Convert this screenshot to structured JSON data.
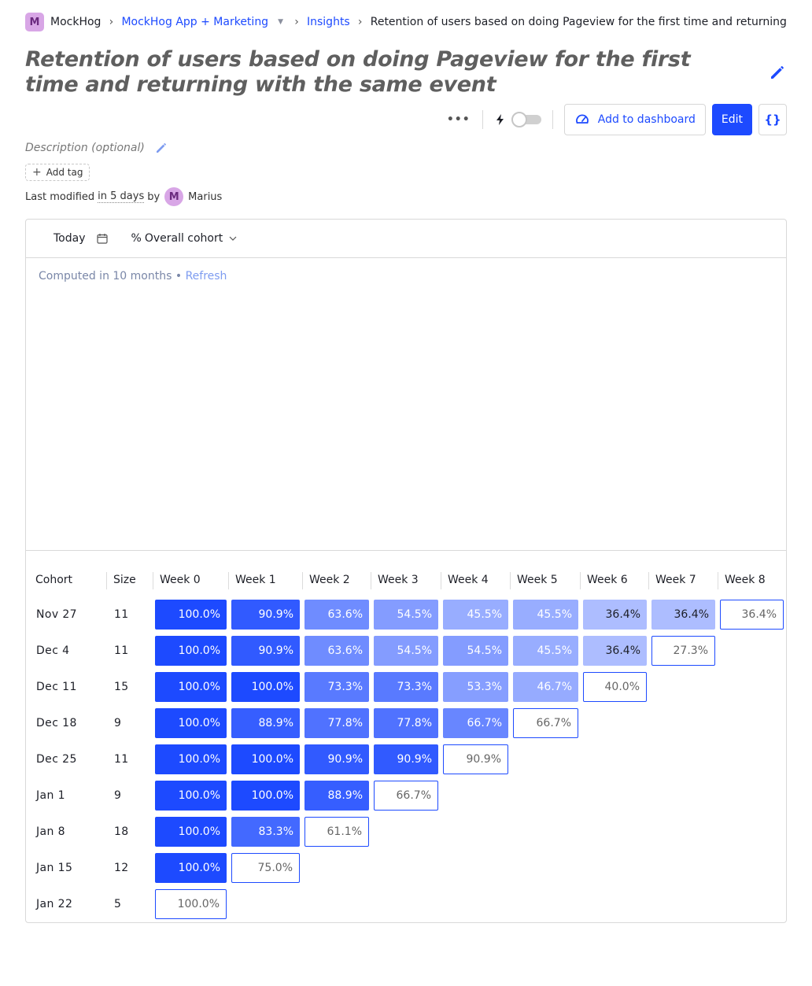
{
  "breadcrumbs": {
    "org_initial": "M",
    "org": "MockHog",
    "project": "MockHog App + Marketing",
    "section": "Insights",
    "current": "Retention of users based on doing Pageview for the first time and returning with the same event"
  },
  "title": "Retention of users based on doing Pageview for the first time and returning with the same event",
  "toolbar": {
    "more_label": "•••",
    "add_to_dashboard": "Add to dashboard",
    "edit": "Edit",
    "code_label": "{}"
  },
  "description_placeholder": "Description (optional)",
  "add_tag": "Add tag",
  "last_modified": {
    "prefix": "Last modified",
    "relative": "in 5 days",
    "by": "by",
    "user_initial": "M",
    "user": "Marius"
  },
  "filters": {
    "date": "Today",
    "cohort_mode": "Overall cohort",
    "cohort_prefix": "%"
  },
  "computed": {
    "text": "Computed in 10 months",
    "bullet": "•",
    "refresh": "Refresh"
  },
  "colors": {
    "accent": "#1d4aff",
    "cell_base_rgb": "29,74,255"
  },
  "chart_data": {
    "type": "table",
    "columns": [
      "Cohort",
      "Size",
      "Week 0",
      "Week 1",
      "Week 2",
      "Week 3",
      "Week 4",
      "Week 5",
      "Week 6",
      "Week 7",
      "Week 8"
    ],
    "rows": [
      {
        "cohort": "Nov 27",
        "size": "11",
        "values": [
          "100.0%",
          "90.9%",
          "63.6%",
          "54.5%",
          "45.5%",
          "45.5%",
          "36.4%",
          "36.4%",
          "36.4%"
        ]
      },
      {
        "cohort": "Dec 4",
        "size": "11",
        "values": [
          "100.0%",
          "90.9%",
          "63.6%",
          "54.5%",
          "54.5%",
          "45.5%",
          "36.4%",
          "27.3%"
        ]
      },
      {
        "cohort": "Dec 11",
        "size": "15",
        "values": [
          "100.0%",
          "100.0%",
          "73.3%",
          "73.3%",
          "53.3%",
          "46.7%",
          "40.0%"
        ]
      },
      {
        "cohort": "Dec 18",
        "size": "9",
        "values": [
          "100.0%",
          "88.9%",
          "77.8%",
          "77.8%",
          "66.7%",
          "66.7%"
        ]
      },
      {
        "cohort": "Dec 25",
        "size": "11",
        "values": [
          "100.0%",
          "100.0%",
          "90.9%",
          "90.9%",
          "90.9%"
        ]
      },
      {
        "cohort": "Jan 1",
        "size": "9",
        "values": [
          "100.0%",
          "100.0%",
          "88.9%",
          "66.7%"
        ]
      },
      {
        "cohort": "Jan 8",
        "size": "18",
        "values": [
          "100.0%",
          "83.3%",
          "61.1%"
        ]
      },
      {
        "cohort": "Jan 15",
        "size": "12",
        "values": [
          "100.0%",
          "75.0%"
        ]
      },
      {
        "cohort": "Jan 22",
        "size": "5",
        "values": [
          "100.0%"
        ]
      }
    ]
  }
}
